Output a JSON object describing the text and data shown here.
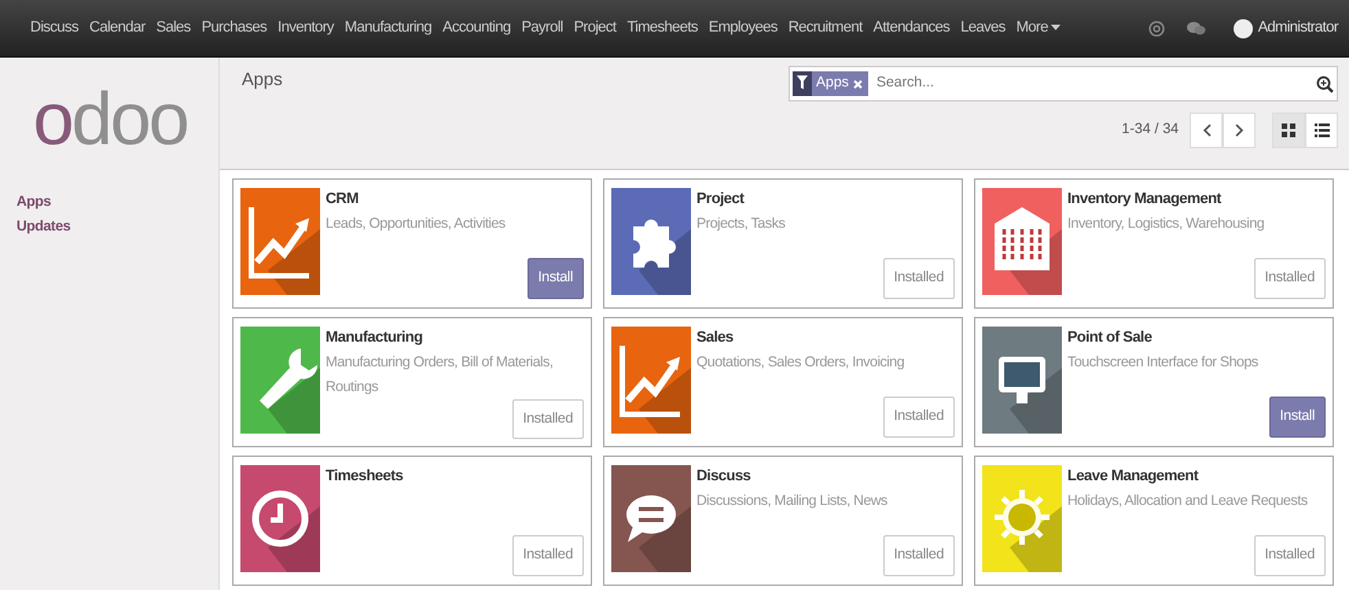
{
  "top_menu": {
    "items": [
      "Discuss",
      "Calendar",
      "Sales",
      "Purchases",
      "Inventory",
      "Manufacturing",
      "Accounting",
      "Payroll",
      "Project",
      "Timesheets",
      "Employees",
      "Recruitment",
      "Attendances",
      "Leaves"
    ],
    "more": "More",
    "user": "Administrator"
  },
  "sidebar": {
    "logo": "odoo",
    "items": [
      "Apps",
      "Updates"
    ]
  },
  "control_panel": {
    "title": "Apps",
    "facet": "Apps",
    "search_placeholder": "Search...",
    "pager": "1-34 / 34",
    "views": [
      {
        "kind": "kanban",
        "selected": true
      },
      {
        "kind": "list",
        "selected": false
      }
    ]
  },
  "apps": [
    {
      "name": "CRM",
      "summary": "Leads, Opportunities, Activities",
      "kind": "chart",
      "color": "#e8640f",
      "installed": false,
      "button": "Install"
    },
    {
      "name": "Project",
      "summary": "Projects, Tasks",
      "kind": "puzzle",
      "color": "#5b6bb5",
      "installed": true,
      "button": "Installed"
    },
    {
      "name": "Inventory Management",
      "summary": "Inventory, Logistics, Warehousing",
      "kind": "building",
      "color": "#f0605e",
      "installed": true,
      "button": "Installed"
    },
    {
      "name": "Manufacturing",
      "summary": "Manufacturing Orders, Bill of Materials, Routings",
      "kind": "wrench",
      "color": "#4fb84a",
      "installed": true,
      "button": "Installed"
    },
    {
      "name": "Sales",
      "summary": "Quotations, Sales Orders, Invoicing",
      "kind": "chart",
      "color": "#e8640f",
      "installed": true,
      "button": "Installed"
    },
    {
      "name": "Point of Sale",
      "summary": "Touchscreen Interface for Shops",
      "kind": "monitor",
      "color": "#6e7b80",
      "installed": false,
      "button": "Install"
    },
    {
      "name": "Timesheets",
      "kind": "clock",
      "color": "#c6496e",
      "installed": true,
      "button": "Installed"
    },
    {
      "name": "Discuss",
      "summary": "Discussions, Mailing Lists, News",
      "kind": "chat",
      "color": "#85554f",
      "installed": true,
      "button": "Installed"
    },
    {
      "name": "Leave Management",
      "summary": "Holidays, Allocation and Leave Requests",
      "kind": "sun",
      "color": "#f2e31a",
      "installed": true,
      "button": "Installed"
    }
  ]
}
